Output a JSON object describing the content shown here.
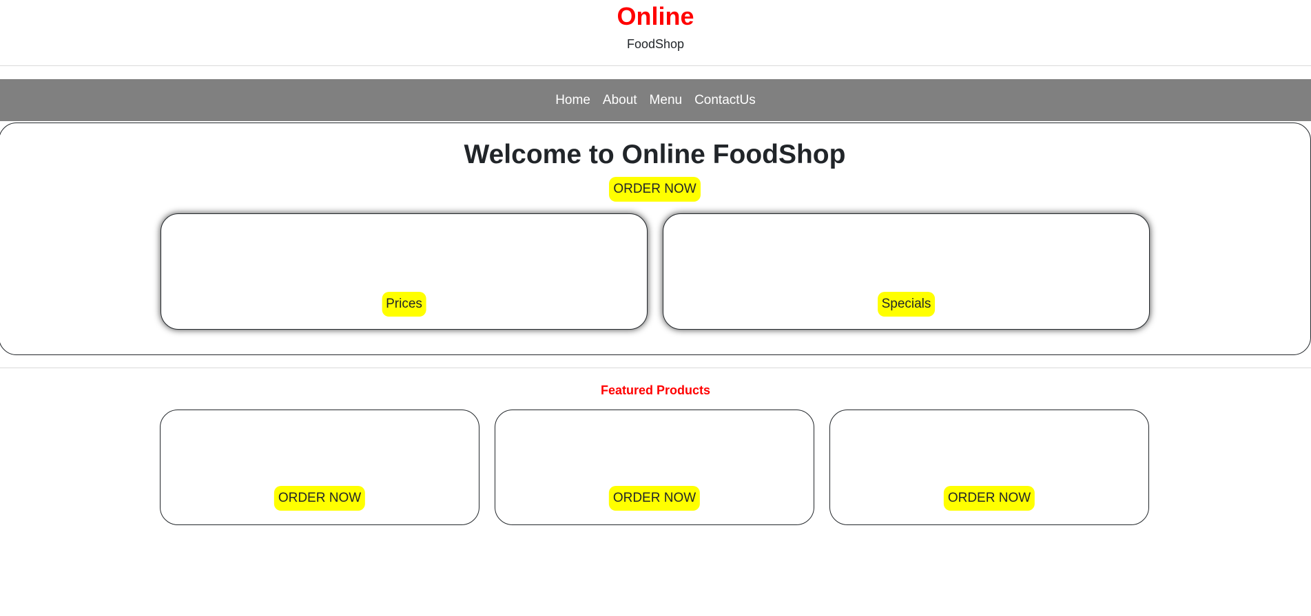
{
  "header": {
    "title": "Online",
    "subtitle": "FoodShop"
  },
  "nav": {
    "items": [
      {
        "label": "Home"
      },
      {
        "label": "About"
      },
      {
        "label": "Menu"
      },
      {
        "label": "ContactUs"
      }
    ]
  },
  "hero": {
    "heading": "Welcome to Online FoodShop",
    "order_label": "ORDER NOW",
    "cards": [
      {
        "button_label": "Prices"
      },
      {
        "button_label": "Specials"
      }
    ]
  },
  "featured": {
    "title": "Featured Products",
    "products": [
      {
        "button_label": "ORDER NOW"
      },
      {
        "button_label": "ORDER NOW"
      },
      {
        "button_label": "ORDER NOW"
      }
    ]
  },
  "colors": {
    "brand_red": "#ff0000",
    "nav_gray": "#808080",
    "button_yellow": "#ffff00"
  }
}
